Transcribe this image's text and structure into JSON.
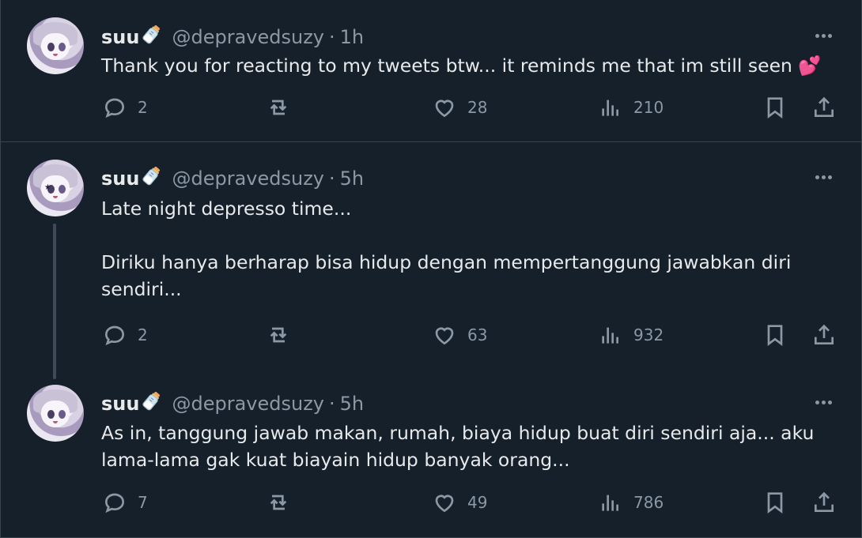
{
  "tweets": [
    {
      "name": "suu",
      "handle": "@depravedsuzy",
      "separator": "·",
      "time": "1h",
      "text": "Thank you for reacting to my tweets btw... it reminds me that im still seen 💕",
      "replies": "2",
      "retweets": "",
      "likes": "28",
      "views": "210"
    },
    {
      "name": "suu",
      "handle": "@depravedsuzy",
      "separator": "·",
      "time": "5h",
      "text": "Late night depresso time...\n\nDiriku hanya berharap bisa hidup dengan mempertanggung jawabkan diri sendiri...",
      "replies": "2",
      "retweets": "",
      "likes": "63",
      "views": "932"
    },
    {
      "name": "suu",
      "handle": "@depravedsuzy",
      "separator": "·",
      "time": "5h",
      "text": "As in, tanggung jawab makan, rumah, biaya hidup buat diri sendiri aja... aku lama-lama gak kuat biayain hidup banyak orang...",
      "replies": "7",
      "retweets": "",
      "likes": "49",
      "views": "786"
    }
  ],
  "icons": {
    "name_emoji": "baby-bottle-icon",
    "more": "more-icon",
    "reply": "reply-icon",
    "retweet": "retweet-icon",
    "like": "heart-icon",
    "views": "views-icon",
    "bookmark": "bookmark-icon",
    "share": "share-icon"
  },
  "colors": {
    "background": "#15202b",
    "text": "#e7e9ea",
    "secondary": "#8b98a5",
    "border": "#38444d"
  }
}
